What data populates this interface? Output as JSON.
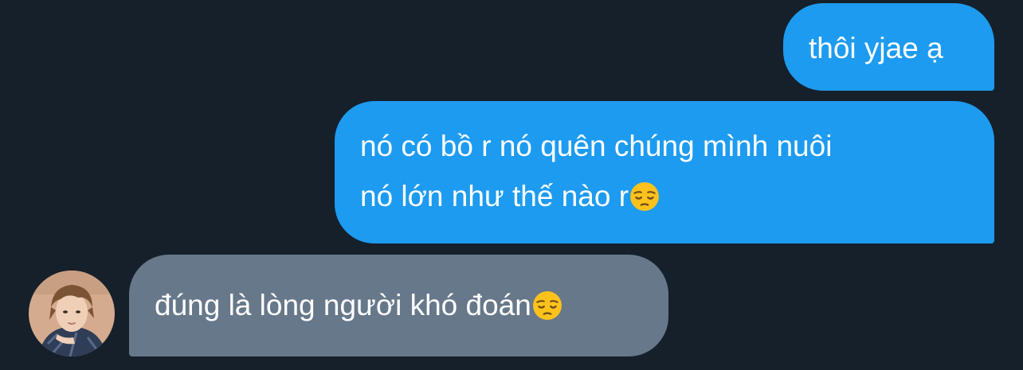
{
  "conversation": {
    "messages": [
      {
        "direction": "sent",
        "lines": [
          "thôi yjae ạ"
        ],
        "trailing_emoji": ""
      },
      {
        "direction": "sent",
        "lines": [
          "nó có bồ r nó quên chúng mình nuôi",
          "nó lớn như thế nào r"
        ],
        "trailing_emoji": "pensive-face-icon"
      },
      {
        "direction": "received",
        "lines": [
          "đúng là lòng người khó đoán"
        ],
        "trailing_emoji": "pensive-face-icon",
        "avatar": "user-avatar"
      }
    ]
  },
  "colors": {
    "background": "#15202b",
    "sent_bubble": "#1d9bf0",
    "received_bubble": "#67788a",
    "text": "#ffffff"
  }
}
